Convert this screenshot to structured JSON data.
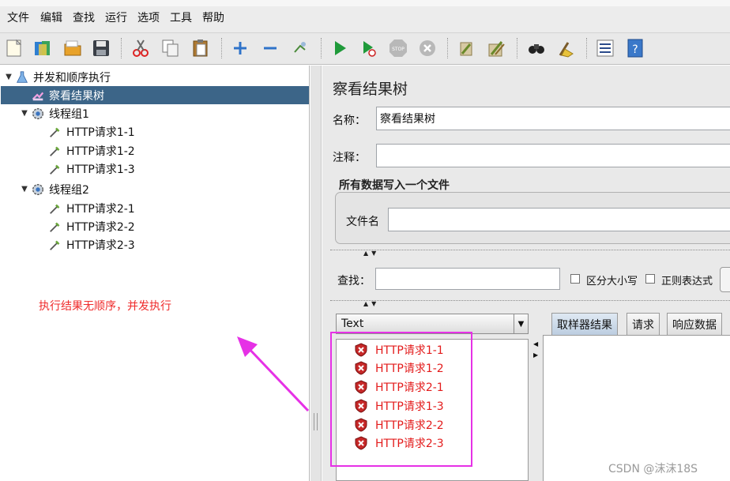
{
  "menu": [
    "文件",
    "编辑",
    "查找",
    "运行",
    "选项",
    "工具",
    "帮助"
  ],
  "toolbar_icons": [
    "new-icon",
    "templates-icon",
    "open-icon",
    "save-icon",
    "cut-icon",
    "copy-icon",
    "paste-icon",
    "expand-icon",
    "collapse-icon",
    "toggle-icon",
    "start-icon",
    "start-no-pause-icon",
    "stop-icon",
    "shutdown-icon",
    "clear-icon",
    "clear-all-icon",
    "search-icon",
    "reset-search-icon",
    "function-helper-icon",
    "help-icon"
  ],
  "tree": {
    "items": [
      {
        "label": "并发和顺序执行",
        "icon": "test-plan-icon",
        "level": 0,
        "expanded": true
      },
      {
        "label": "察看结果树",
        "icon": "listener-icon",
        "level": 1,
        "selected": true
      },
      {
        "label": "线程组1",
        "icon": "thread-group-icon",
        "level": 1,
        "expanded": true
      },
      {
        "label": "HTTP请求1-1",
        "icon": "sampler-icon",
        "level": 2
      },
      {
        "label": "HTTP请求1-2",
        "icon": "sampler-icon",
        "level": 2
      },
      {
        "label": "HTTP请求1-3",
        "icon": "sampler-icon",
        "level": 2
      },
      {
        "label": "线程组2",
        "icon": "thread-group-icon",
        "level": 1,
        "expanded": true
      },
      {
        "label": "HTTP请求2-1",
        "icon": "sampler-icon",
        "level": 2
      },
      {
        "label": "HTTP请求2-2",
        "icon": "sampler-icon",
        "level": 2
      },
      {
        "label": "HTTP请求2-3",
        "icon": "sampler-icon",
        "level": 2
      }
    ]
  },
  "annotation": {
    "text": "执行结果无顺序，并发执行",
    "color": "#ef2b2b",
    "arrow_color": "#e631e6"
  },
  "panel": {
    "title": "察看结果树",
    "name_label": "名称：",
    "name_value": "察看结果树",
    "comment_label": "注释：",
    "comment_value": "",
    "file_group_title": "所有数据写入一个文件",
    "filename_label": "文件名",
    "filename_value": "",
    "search_label": "查找：",
    "search_value": "",
    "case_sensitive_label": "区分大小写",
    "regex_label": "正则表达式",
    "renderer_value": "Text"
  },
  "results": [
    "HTTP请求1-1",
    "HTTP请求1-2",
    "HTTP请求2-1",
    "HTTP请求1-3",
    "HTTP请求2-2",
    "HTTP请求2-3"
  ],
  "result_status": "failed",
  "tabs": [
    "取样器结果",
    "请求",
    "响应数据"
  ],
  "active_tab": 0,
  "colors": {
    "selection": "#3c6588",
    "error_text": "#e31b1b",
    "highlight_box": "#e631e6"
  },
  "watermark": "CSDN @沫沫18S"
}
